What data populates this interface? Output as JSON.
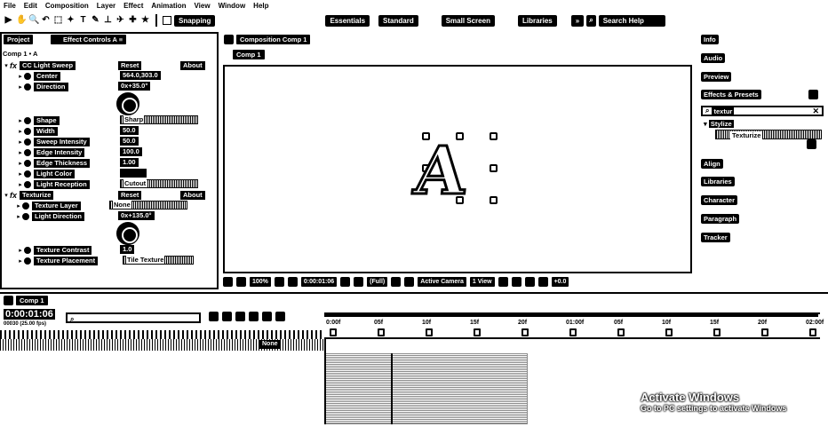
{
  "menu": [
    "File",
    "Edit",
    "Composition",
    "Layer",
    "Effect",
    "Animation",
    "View",
    "Window",
    "Help"
  ],
  "toolbar": {
    "tools": [
      "▶",
      "✋",
      "🔍",
      "↶",
      "⬚",
      "✦",
      "T",
      "✎",
      "⊥",
      "✈",
      "✚",
      "★"
    ],
    "snapping": "Snapping",
    "workspaces": [
      "Essentials",
      "Standard",
      "Small Screen",
      "Libraries"
    ],
    "more": "»",
    "search": "Search Help"
  },
  "left_panel": {
    "tab_project": "Project",
    "tab_effect_controls": "Effect Controls A",
    "layer_path": "Comp 1 • A",
    "effects": [
      {
        "type": "effect",
        "name": "CC Light Sweep",
        "reset": "Reset",
        "about": "About"
      },
      {
        "type": "prop",
        "name": "Center",
        "value": "564.0,303.0"
      },
      {
        "type": "prop",
        "name": "Direction",
        "value": "0x+35.0°"
      },
      {
        "type": "prop",
        "name": "Shape",
        "value": "Sharp"
      },
      {
        "type": "prop",
        "name": "Width",
        "value": "50.0"
      },
      {
        "type": "prop",
        "name": "Sweep Intensity",
        "value": "50.0"
      },
      {
        "type": "prop",
        "name": "Edge Intensity",
        "value": "100.0"
      },
      {
        "type": "prop",
        "name": "Edge Thickness",
        "value": "1.00"
      },
      {
        "type": "prop",
        "name": "Light Color",
        "value": ""
      },
      {
        "type": "prop",
        "name": "Light Reception",
        "value": "Cutout"
      },
      {
        "type": "effect",
        "name": "Texturize",
        "reset": "Reset",
        "about": "About"
      },
      {
        "type": "prop",
        "name": "Texture Layer",
        "value": "None"
      },
      {
        "type": "prop",
        "name": "Light Direction",
        "value": "0x+135.0°"
      },
      {
        "type": "prop",
        "name": "Texture Contrast",
        "value": "1.0"
      },
      {
        "type": "prop",
        "name": "Texture Placement",
        "value": "Tile Texture"
      }
    ]
  },
  "composition": {
    "tab": "Composition Comp 1",
    "subtab": "Comp 1",
    "glyph": "A",
    "footer": {
      "zoom": "100%",
      "timecode": "0:00:01:06",
      "quality": "(Full)",
      "camera": "Active Camera",
      "views": "1 View",
      "exposure": "+0.0"
    }
  },
  "right_panel": {
    "items": [
      "Info",
      "Audio",
      "Preview",
      "Effects & Presets"
    ],
    "search_value": "textur",
    "category": "Stylize",
    "effect_result": "Texturize",
    "more_items": [
      "Align",
      "Libraries",
      "Character",
      "Paragraph",
      "Tracker"
    ]
  },
  "timeline": {
    "tab": "Comp 1",
    "timecode": "0:00:01:06",
    "frame_info": "00030 (25.00 fps)",
    "search_placeholder": "",
    "ruler_ticks": [
      "0:00f",
      "05f",
      "10f",
      "15f",
      "20f",
      "01:00f",
      "05f",
      "10f",
      "15f",
      "20f",
      "02:00f"
    ],
    "layer_parent": "None"
  },
  "watermark": {
    "title": "Activate Windows",
    "subtitle": "Go to PC settings to activate Windows"
  }
}
